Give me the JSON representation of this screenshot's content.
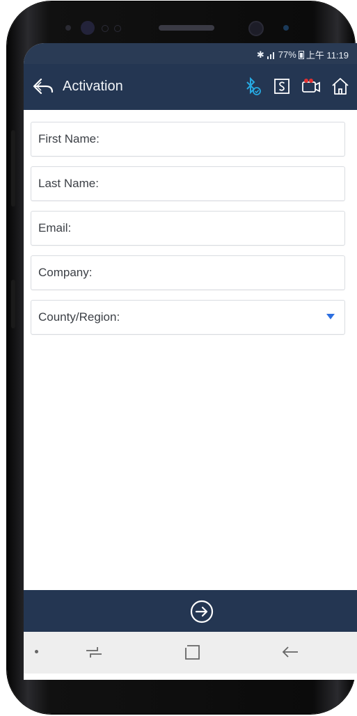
{
  "status_bar": {
    "battery": "77%",
    "time": "上午 11:19"
  },
  "app_bar": {
    "title": "Activation"
  },
  "form": {
    "fields": [
      {
        "label": "First Name:"
      },
      {
        "label": "Last Name:"
      },
      {
        "label": "Email:"
      },
      {
        "label": "Company:"
      },
      {
        "label": "County/Region:"
      }
    ]
  },
  "icons": {
    "back": "back-arrow-icon",
    "bluetooth": "bluetooth-connected-icon",
    "s_box": "s-box-icon",
    "camera": "camera-icon",
    "home": "home-icon",
    "next": "arrow-right-circle-icon",
    "nav_recent": "recent-apps-icon",
    "nav_home": "home-square-icon",
    "nav_back": "back-nav-icon"
  },
  "colors": {
    "header": "#243652",
    "status": "#2a3b55",
    "accent_blue": "#2d6fe0",
    "bluetooth": "#27a9e1",
    "camera_dot": "#e33030"
  }
}
